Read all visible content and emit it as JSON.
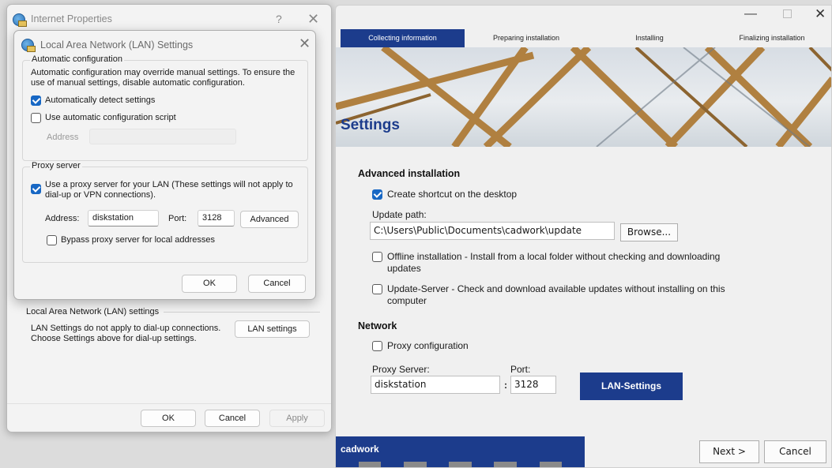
{
  "internet_properties": {
    "title": "Internet Properties",
    "help_glyph": "?",
    "close_glyph": "✕",
    "lan_group_legend": "Local Area Network (LAN) settings",
    "lan_group_text_1": "LAN Settings do not apply to dial-up connections.",
    "lan_group_text_2": "Choose Settings above for dial-up settings.",
    "lan_settings_button": "LAN settings",
    "ok_button": "OK",
    "cancel_button": "Cancel",
    "apply_button": "Apply"
  },
  "lan_dialog": {
    "title": "Local Area Network (LAN) Settings",
    "close_glyph": "✕",
    "auto_config": {
      "legend": "Automatic configuration",
      "description": "Automatic configuration may override manual settings.  To ensure the use of manual settings, disable automatic configuration.",
      "auto_detect_label": "Automatically detect settings",
      "auto_detect_checked": true,
      "use_script_label": "Use automatic configuration script",
      "use_script_checked": false,
      "address_label": "Address",
      "address_value": ""
    },
    "proxy": {
      "legend": "Proxy server",
      "use_proxy_label": "Use a proxy server for your LAN (These settings will not apply to dial-up or VPN connections).",
      "use_proxy_checked": true,
      "address_label": "Address:",
      "address_value": "diskstation",
      "port_label": "Port:",
      "port_value": "3128",
      "advanced_button": "Advanced",
      "bypass_label": "Bypass proxy server for local addresses",
      "bypass_checked": false
    },
    "ok_button": "OK",
    "cancel_button": "Cancel"
  },
  "cadwork": {
    "window_controls": {
      "minimize": "—",
      "close": "✕"
    },
    "steps": [
      "Collecting information",
      "Preparing installation",
      "Installing",
      "Finalizing installation"
    ],
    "active_step": 0,
    "page_title": "Settings",
    "advanced": {
      "heading": "Advanced installation",
      "shortcut_label": "Create shortcut on the desktop",
      "shortcut_checked": true,
      "update_path_label": "Update path:",
      "update_path_value": "C:\\Users\\Public\\Documents\\cadwork\\update",
      "browse_button": "Browse...",
      "offline_label_1": "Offline installation - Install from a local folder without checking and downloading",
      "offline_label_2": "updates",
      "offline_checked": false,
      "update_server_label_1": "Update-Server - Check and download available updates without installing on this",
      "update_server_label_2": "computer",
      "update_server_checked": false
    },
    "network": {
      "heading": "Network",
      "proxy_config_label": "Proxy configuration",
      "proxy_config_checked": false,
      "proxy_server_label": "Proxy Server:",
      "proxy_server_value": "diskstation",
      "separator": ":",
      "port_label": "Port:",
      "port_value": "3128",
      "lan_settings_button": "LAN-Settings"
    },
    "brand": "cadwork",
    "next_button": "Next >",
    "cancel_button": "Cancel",
    "accent_color": "#1c3c8c"
  }
}
